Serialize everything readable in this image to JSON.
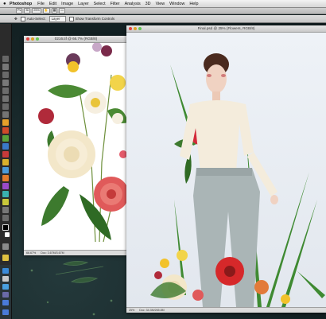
{
  "menubar": {
    "app_name": "Photoshop",
    "items": [
      "File",
      "Edit",
      "Image",
      "Layer",
      "Select",
      "Filter",
      "Analysis",
      "3D",
      "View",
      "Window",
      "Help"
    ]
  },
  "appbar": {
    "zoom": "25%"
  },
  "options": {
    "auto_select_label": "Auto-Select:",
    "auto_select_value": "Layer",
    "transform_label": "Show Transform Controls"
  },
  "window1": {
    "title": "0216.tif @ 66.7% (RGB/8)",
    "status_zoom": "66.67%",
    "status_doc": "Doc: 3.67M/3.67M"
  },
  "window2": {
    "title": "Final.psd @ 25% (Flowers, RGB/8)",
    "status_zoom": "25%",
    "status_doc": "Doc: 34.3M/265.8M"
  },
  "colors": {
    "menubar": "#e8e8e8",
    "tools_panel": "#2b2b2b",
    "desktop": "#142224",
    "flower_red": "#d6282a",
    "flower_cream": "#f3e7c9",
    "leaf_green": "#3d7a2e"
  }
}
